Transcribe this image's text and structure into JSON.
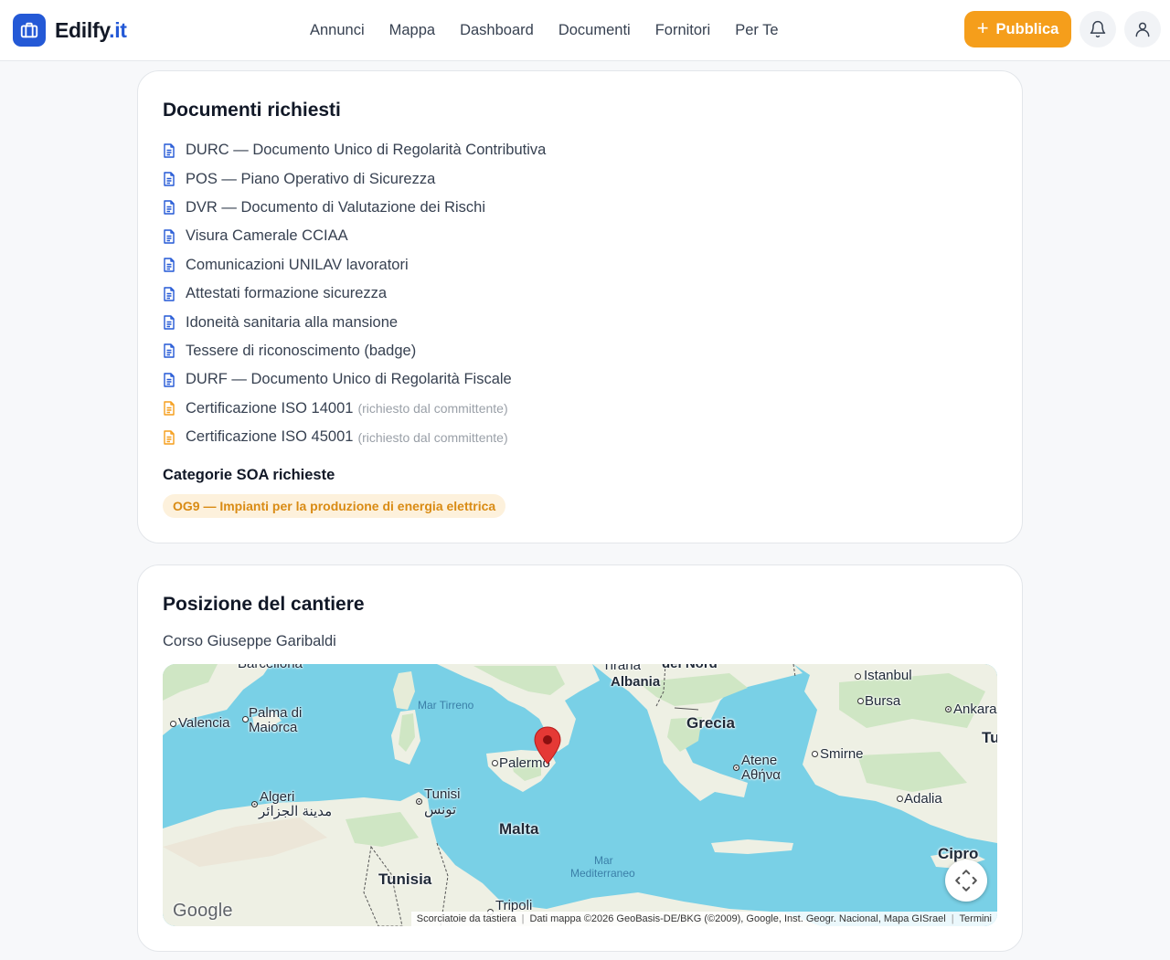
{
  "header": {
    "brand_name": "Edilfy",
    "brand_tld": ".it",
    "nav": [
      "Annunci",
      "Mappa",
      "Dashboard",
      "Documenti",
      "Fornitori",
      "Per Te"
    ],
    "publish_label": "Pubblica",
    "accent_color": "#f59e1b",
    "brand_color": "#2459d6"
  },
  "documents": {
    "title": "Documenti richiesti",
    "items": [
      {
        "label": "DURC — Documento Unico di Regolarità Contributiva",
        "note": "",
        "icon": "document-icon",
        "color": "#2459d6"
      },
      {
        "label": "POS — Piano Operativo di Sicurezza",
        "note": "",
        "icon": "document-icon",
        "color": "#2459d6"
      },
      {
        "label": "DVR — Documento di Valutazione dei Rischi",
        "note": "",
        "icon": "document-icon",
        "color": "#2459d6"
      },
      {
        "label": "Visura Camerale CCIAA",
        "note": "",
        "icon": "document-icon",
        "color": "#2459d6"
      },
      {
        "label": "Comunicazioni UNILAV lavoratori",
        "note": "",
        "icon": "document-icon",
        "color": "#2459d6"
      },
      {
        "label": "Attestati formazione sicurezza",
        "note": "",
        "icon": "document-icon",
        "color": "#2459d6"
      },
      {
        "label": "Idoneità sanitaria alla mansione",
        "note": "",
        "icon": "document-icon",
        "color": "#2459d6"
      },
      {
        "label": "Tessere di riconoscimento (badge)",
        "note": "",
        "icon": "document-icon",
        "color": "#2459d6"
      },
      {
        "label": "DURF — Documento Unico di Regolarità Fiscale",
        "note": "",
        "icon": "document-icon",
        "color": "#2459d6"
      },
      {
        "label": "Certificazione ISO 14001",
        "note": "(richiesto dal committente)",
        "icon": "document-icon",
        "color": "#f59e1b"
      },
      {
        "label": "Certificazione ISO 45001",
        "note": "(richiesto dal committente)",
        "icon": "document-icon",
        "color": "#f59e1b"
      }
    ],
    "soa_title": "Categorie SOA richieste",
    "soa_badge": "OG9 — Impianti per la produzione di energia elettrica"
  },
  "site": {
    "title": "Posizione del cantiere",
    "address": "Corso Giuseppe Garibaldi",
    "map": {
      "labels": {
        "barcellona": "Barcellona",
        "tirana": "Tirana",
        "nord": "del Nord",
        "albania": "Albania",
        "istanbul": "Istanbul",
        "bursa": "Bursa",
        "ankara": "Ankara",
        "tu": "Tu",
        "valencia": "Valencia",
        "palma1": "Palma di",
        "palma2": "Maiorca",
        "mar_tirreno": "Mar Tirreno",
        "grecia": "Grecia",
        "palermo": "Palermo",
        "atene": "Atene",
        "atene_gr": "Αθήνα",
        "smirne": "Smirne",
        "algeri": "Algeri",
        "algeri_ar": "مدينة الجزائر",
        "tunisi": "Tunisi",
        "tunisi_ar": "تونس",
        "adalia": "Adalia",
        "malta": "Malta",
        "mar_med1": "Mar",
        "mar_med2": "Mediterraneo",
        "cipro": "Cipro",
        "tunisia": "Tunisia",
        "tripoli": "Tripoli"
      },
      "google": "Google",
      "shortcuts": "Scorciatoie da tastiera",
      "map_data": "Dati mappa ©2026 GeoBasis-DE/BKG (©2009), Google, Inst. Geogr. Nacional, Mapa GISrael",
      "terms": "Termini"
    }
  }
}
